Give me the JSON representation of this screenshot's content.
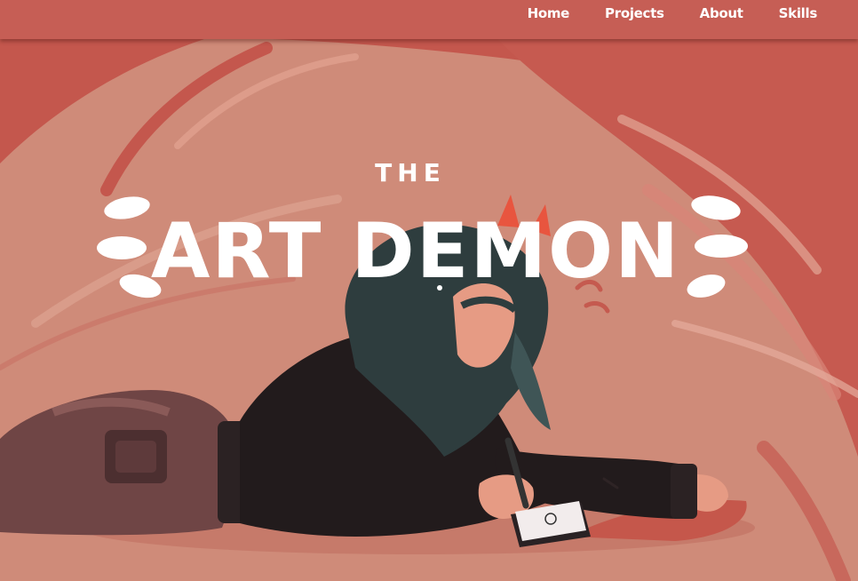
{
  "nav": {
    "items": [
      {
        "label": "Home"
      },
      {
        "label": "Projects"
      },
      {
        "label": "About"
      },
      {
        "label": "Skills"
      }
    ]
  },
  "hero": {
    "logo_small": "THE",
    "logo_big": "ART DEMON"
  },
  "colors": {
    "navbar": "#c65e55",
    "background": "#d08a78",
    "accent_red": "#c4574d",
    "hoodie": "#231c1d",
    "hair": "#2e3d3e",
    "skin": "#e79a82"
  }
}
